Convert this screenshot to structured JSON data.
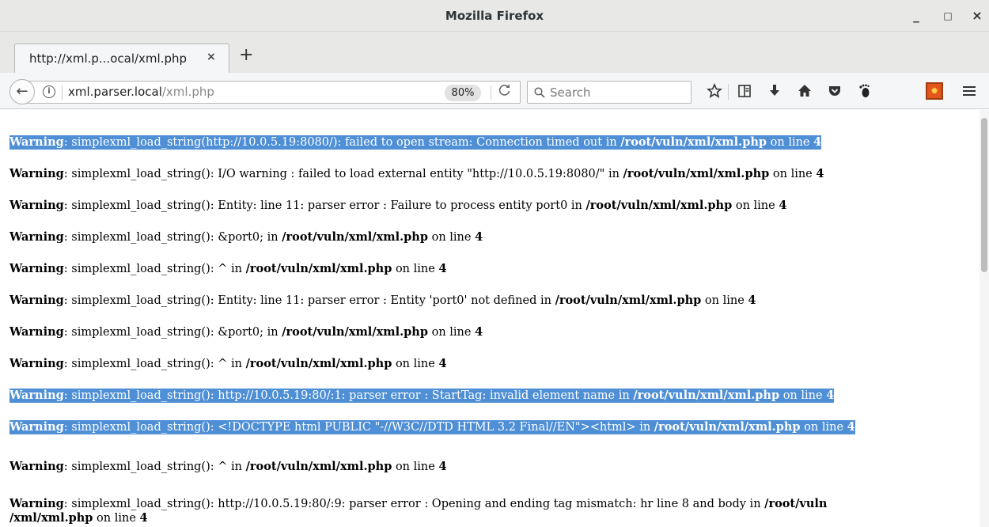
{
  "window": {
    "title": "Mozilla Firefox",
    "controls": {
      "minimize": "_",
      "maximize": "□",
      "close": "×"
    }
  },
  "tab": {
    "label": "http://xml.p...ocal/xml.php",
    "close": "×",
    "new_tab": "+"
  },
  "navbar": {
    "back": "←",
    "url_host": "xml.parser.local",
    "url_path": "/xml.php",
    "zoom": "80%",
    "reload": "C",
    "search_placeholder": "Search",
    "icons": [
      "star-icon",
      "reader-list-icon",
      "download-icon",
      "home-icon",
      "pocket-icon",
      "foot-icon",
      "extension-icon",
      "menu-icon"
    ]
  },
  "colors": {
    "selection": "#4f8fd6",
    "titlebar": "#e8e8e7"
  },
  "page": {
    "lines": [
      {
        "label": "Warning",
        "text": ": simplexml_load_string(http://10.0.5.19:8080/): failed to open stream: Connection timed out in ",
        "path": "/root/vuln/xml/xml.php",
        "on": " on line ",
        "num": "4",
        "highlighted": true
      },
      {
        "label": "Warning",
        "text": ": simplexml_load_string(): I/O warning : failed to load external entity \"http://10.0.5.19:8080/\" in ",
        "path": "/root/vuln/xml/xml.php",
        "on": " on line ",
        "num": "4",
        "highlighted": false
      },
      {
        "label": "Warning",
        "text": ": simplexml_load_string(): Entity: line 11: parser error : Failure to process entity port0 in ",
        "path": "/root/vuln/xml/xml.php",
        "on": " on line ",
        "num": "4",
        "highlighted": false
      },
      {
        "label": "Warning",
        "text": ": simplexml_load_string(): &port0; in ",
        "path": "/root/vuln/xml/xml.php",
        "on": " on line ",
        "num": "4",
        "highlighted": false
      },
      {
        "label": "Warning",
        "text": ": simplexml_load_string(): ^ in ",
        "path": "/root/vuln/xml/xml.php",
        "on": " on line ",
        "num": "4",
        "highlighted": false
      },
      {
        "label": "Warning",
        "text": ": simplexml_load_string(): Entity: line 11: parser error : Entity 'port0' not defined in ",
        "path": "/root/vuln/xml/xml.php",
        "on": " on line ",
        "num": "4",
        "highlighted": false
      },
      {
        "label": "Warning",
        "text": ": simplexml_load_string(): &port0; in ",
        "path": "/root/vuln/xml/xml.php",
        "on": " on line ",
        "num": "4",
        "highlighted": false
      },
      {
        "label": "Warning",
        "text": ": simplexml_load_string(): ^ in ",
        "path": "/root/vuln/xml/xml.php",
        "on": " on line ",
        "num": "4",
        "highlighted": false
      },
      {
        "label": "Warning",
        "text": ": simplexml_load_string(): http://10.0.5.19:80/:1: parser error : StartTag: invalid element name in ",
        "path": "/root/vuln/xml/xml.php",
        "on": " on line ",
        "num": "4",
        "highlighted": true
      },
      {
        "label": "Warning",
        "text": ": simplexml_load_string(): <!DOCTYPE html PUBLIC \"-//W3C//DTD HTML 3.2 Final//EN\"><html> in ",
        "path": "/root/vuln/xml/xml.php",
        "on": " on line ",
        "num": "4",
        "highlighted": true
      },
      {
        "label": "Warning",
        "text": ": simplexml_load_string(): ^ in ",
        "path": "/root/vuln/xml/xml.php",
        "on": " on line ",
        "num": "4",
        "highlighted": false
      }
    ],
    "last": {
      "label": "Warning",
      "text": ": simplexml_load_string(): http://10.0.5.19:80/:9: parser error : Opening and ending tag mismatch: hr line 8 and body in ",
      "path_a": "/root/vuln",
      "path_b": "/xml/xml.php",
      "on": " on line ",
      "num": "4"
    }
  }
}
